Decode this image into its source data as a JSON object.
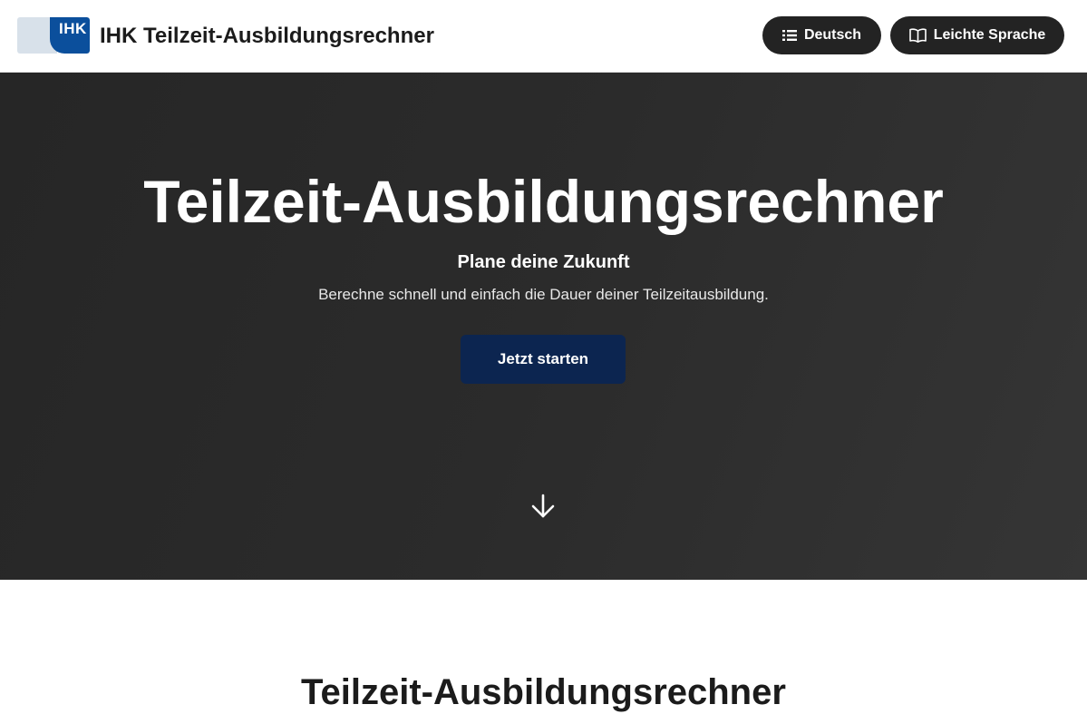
{
  "header": {
    "logo_text": "IHK",
    "title": "IHK Teilzeit-Ausbildungsrechner",
    "language_button": {
      "label": "Deutsch",
      "icon": "list-icon"
    },
    "easy_language_button": {
      "label": "Leichte Sprache",
      "icon": "book-icon"
    }
  },
  "hero": {
    "title": "Teilzeit-Ausbildungsrechner",
    "subtitle": "Plane deine Zukunft",
    "description": "Berechne schnell und einfach die Dauer deiner Teilzeitausbildung.",
    "cta_label": "Jetzt starten",
    "scroll_icon": "arrow-down-icon"
  },
  "section": {
    "title": "Teilzeit-Ausbildungsrechner"
  },
  "colors": {
    "logo_blue": "#0b4f9c",
    "pill_dark": "#232323",
    "cta_navy": "#0c2550",
    "hero_bg": "#2b2b2b"
  }
}
